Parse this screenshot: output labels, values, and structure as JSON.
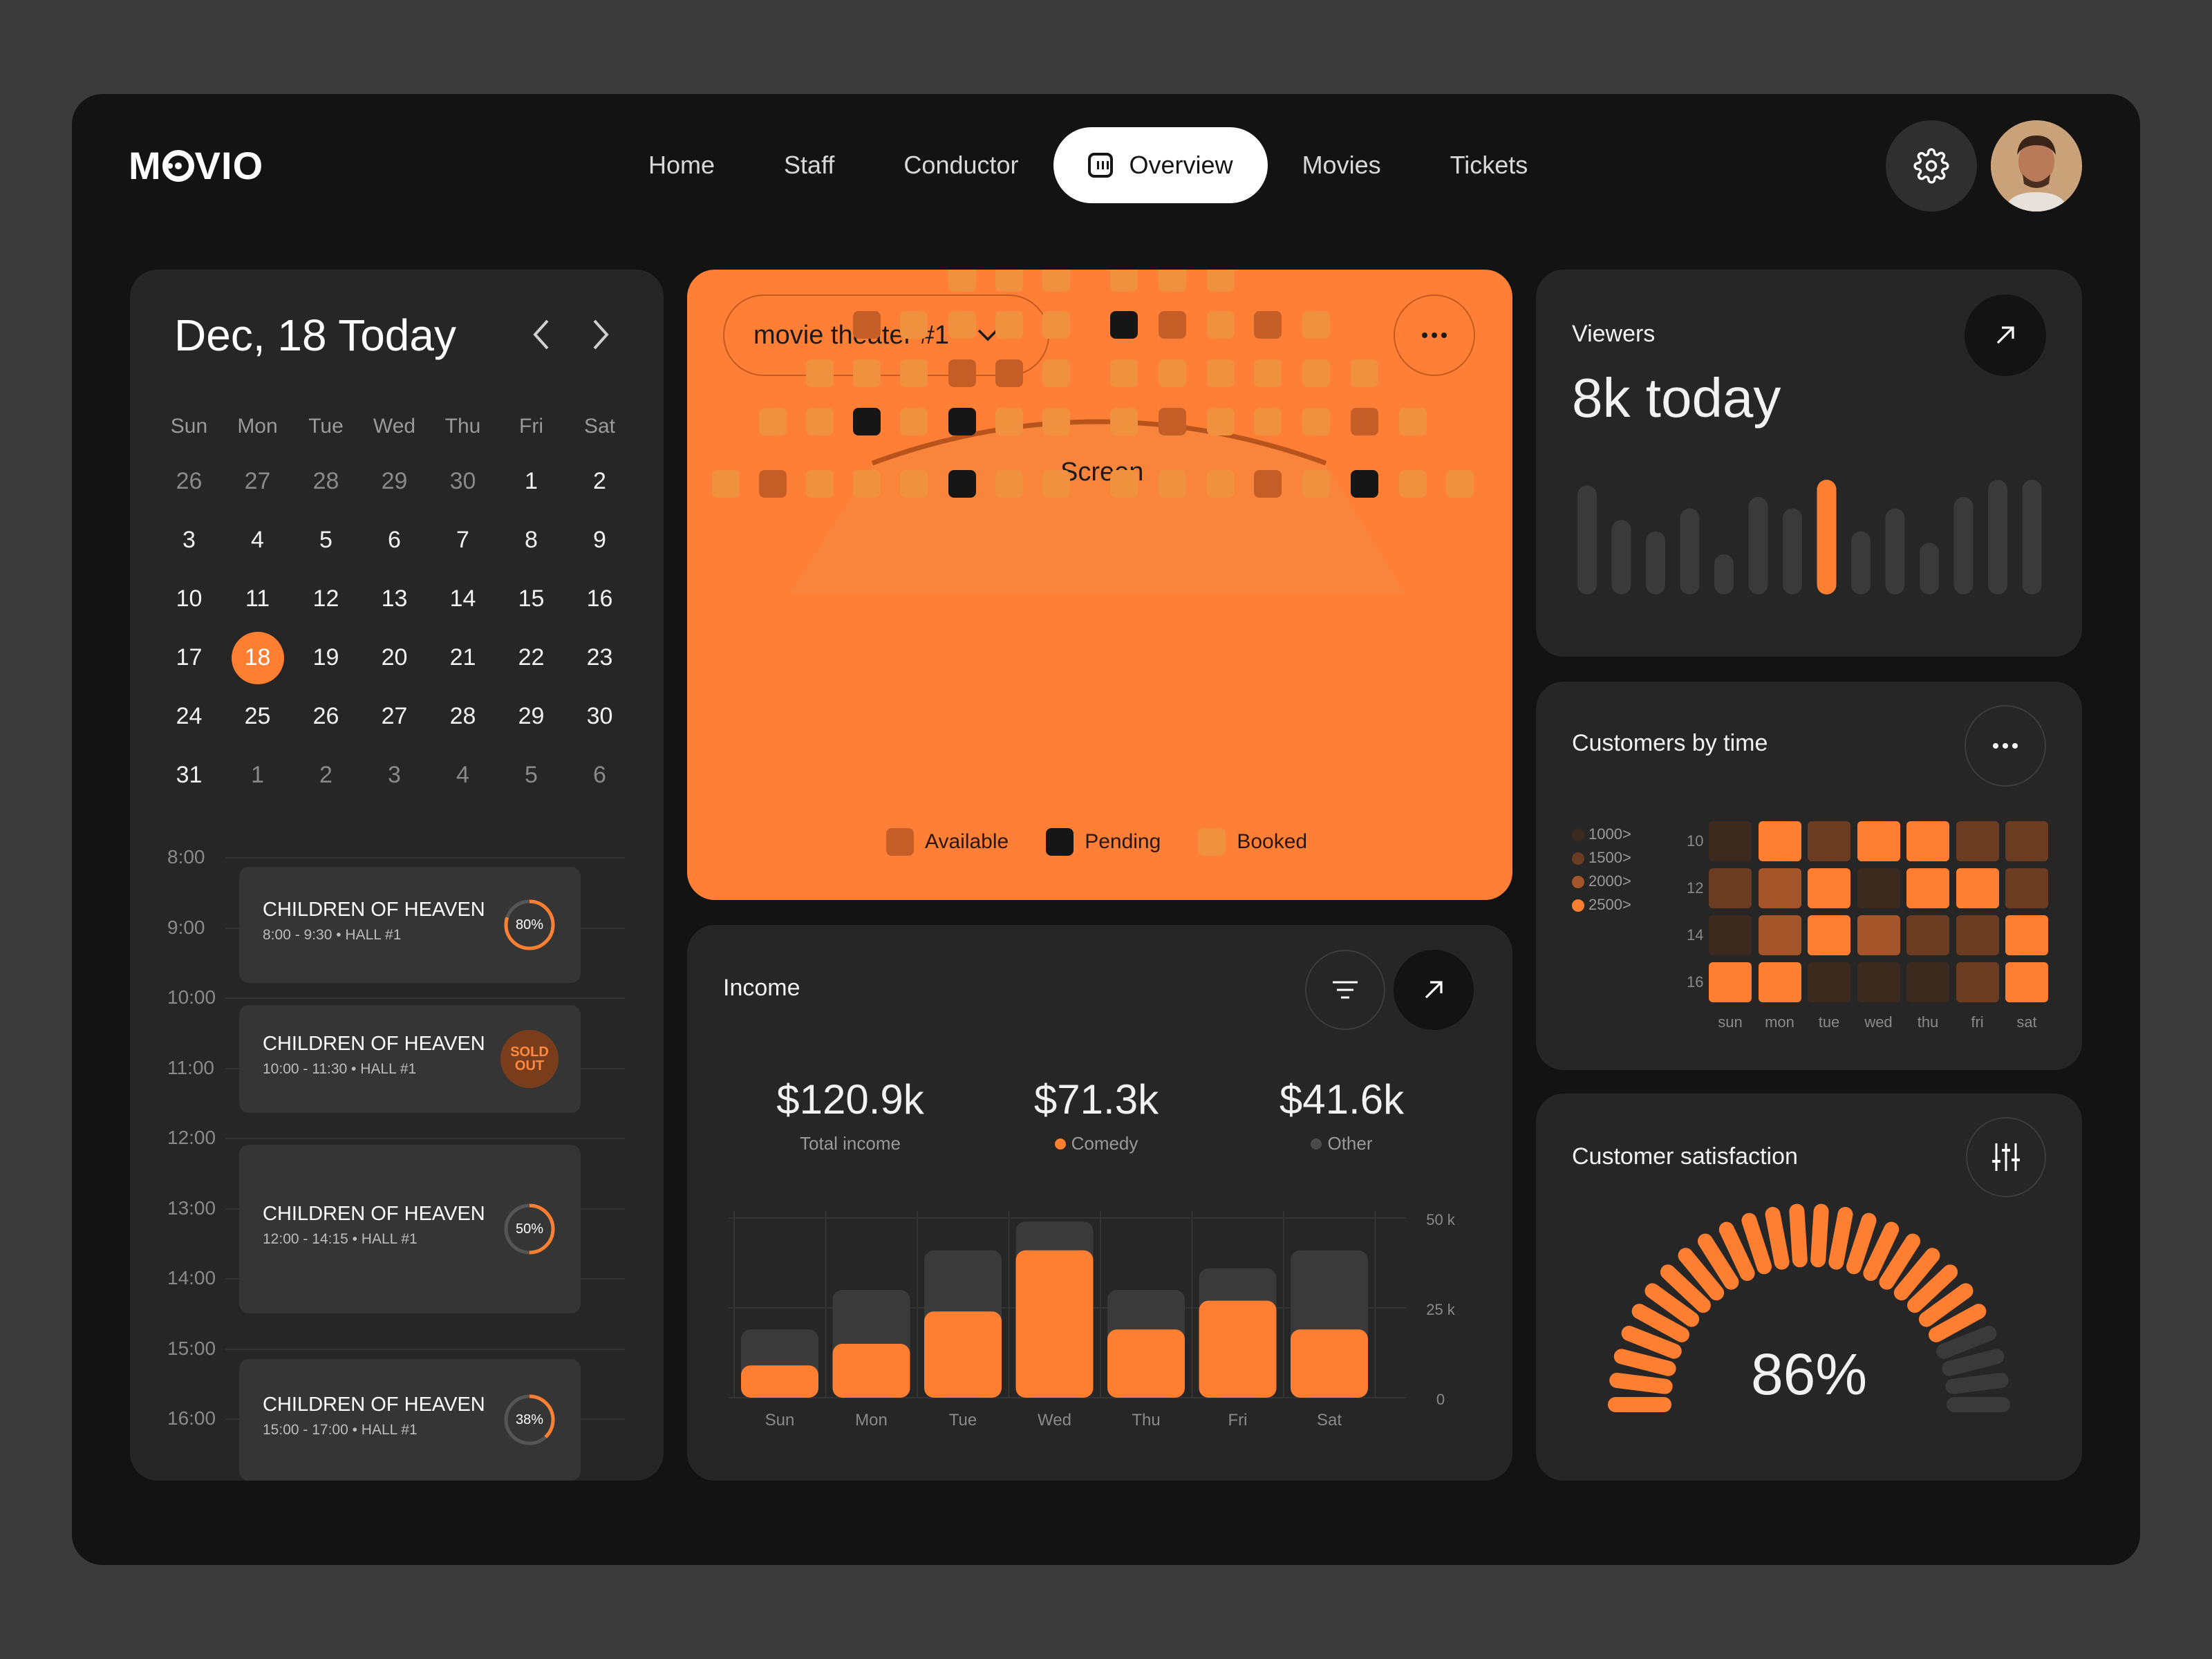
{
  "brand": {
    "logo": "MOVIO"
  },
  "nav": {
    "items": [
      "Home",
      "Staff",
      "Conductor",
      "Overview",
      "Movies",
      "Tickets"
    ],
    "active": "Overview"
  },
  "calendar": {
    "title": "Dec, 18 Today",
    "weekdays": [
      "Sun",
      "Mon",
      "Tue",
      "Wed",
      "Thu",
      "Fri",
      "Sat"
    ],
    "days": [
      "26",
      "27",
      "28",
      "29",
      "30",
      "1",
      "2",
      "3",
      "4",
      "5",
      "6",
      "7",
      "8",
      "9",
      "10",
      "11",
      "12",
      "13",
      "14",
      "15",
      "16",
      "17",
      "18",
      "19",
      "20",
      "21",
      "22",
      "23",
      "24",
      "25",
      "26",
      "27",
      "28",
      "29",
      "30",
      "31",
      "1",
      "2",
      "3",
      "4",
      "5",
      "6"
    ],
    "selected": "18"
  },
  "schedule": {
    "times": [
      "8:00",
      "9:00",
      "10:00",
      "11:00",
      "12:00",
      "13:00",
      "14:00",
      "15:00",
      "16:00"
    ],
    "events": [
      {
        "title": "CHILDREN OF HEAVEN",
        "sub": "8:00 - 9:30 • HALL #1",
        "badge": "80%",
        "progress": 0.8
      },
      {
        "title": "CHILDREN OF HEAVEN",
        "sub": "10:00 - 11:30 • HALL #1",
        "badge": "SOLD OUT",
        "progress": 1.0
      },
      {
        "title": "CHILDREN OF HEAVEN",
        "sub": "12:00 - 14:15 • HALL #1",
        "badge": "50%",
        "progress": 0.5
      },
      {
        "title": "CHILDREN OF HEAVEN",
        "sub": "15:00 - 17:00 • HALL #1",
        "badge": "38%",
        "progress": 0.38
      }
    ]
  },
  "theater": {
    "selector": "movie theater #1",
    "screen_label": "Screen",
    "legend": {
      "available": "Available",
      "pending": "Pending",
      "booked": "Booked"
    },
    "colors": {
      "available": "#c45d26",
      "pending": "#161616",
      "booked": "#f0913f"
    }
  },
  "viewers": {
    "title": "Viewers",
    "value": "8k today",
    "bars": [
      0.95,
      0.65,
      0.55,
      0.75,
      0.35,
      0.85,
      0.75,
      1.0,
      0.55,
      0.75,
      0.45,
      0.85,
      1.0,
      1.0
    ],
    "highlight_index": 7
  },
  "customers": {
    "title": "Customers by time",
    "legend": [
      "1000>",
      "1500>",
      "2000>",
      "2500>"
    ],
    "rows": [
      "10",
      "12",
      "14",
      "16"
    ],
    "cols": [
      "sun",
      "mon",
      "tue",
      "wed",
      "thu",
      "fri",
      "sat"
    ],
    "levels": [
      [
        0,
        3,
        1,
        3,
        3,
        1,
        1
      ],
      [
        1,
        2,
        3,
        0,
        3,
        3,
        1
      ],
      [
        0,
        2,
        3,
        2,
        1,
        1,
        3
      ],
      [
        3,
        3,
        0,
        0,
        0,
        1,
        3
      ]
    ]
  },
  "income": {
    "title": "Income",
    "stats": [
      {
        "value": "$120.9k",
        "label": "Total income"
      },
      {
        "value": "$71.3k",
        "label": "Comedy"
      },
      {
        "value": "$41.6k",
        "label": "Other"
      }
    ],
    "colors": {
      "comedy": "#ff7f32",
      "other": "#3a3a3a"
    }
  },
  "chart_data": {
    "type": "bar",
    "categories": [
      "Sun",
      "Mon",
      "Tue",
      "Wed",
      "Thu",
      "Fri",
      "Sat"
    ],
    "series": [
      {
        "name": "Comedy",
        "values": [
          9,
          15,
          24,
          41,
          19,
          27,
          19
        ]
      },
      {
        "name": "Other",
        "values": [
          19,
          30,
          41,
          49,
          30,
          36,
          41
        ]
      }
    ],
    "ylim": [
      0,
      50
    ],
    "ytick_labels": [
      "50 k",
      "25 k",
      "0"
    ]
  },
  "satisfaction": {
    "title": "Customer satisfaction",
    "value": "86%",
    "level": 0.86
  }
}
